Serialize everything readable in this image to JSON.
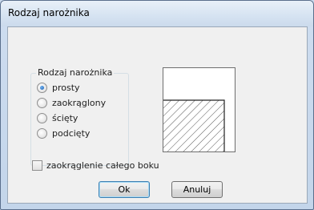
{
  "window": {
    "title": "Rodzaj narożnika"
  },
  "group": {
    "legend": "Rodzaj narożnika",
    "options": [
      {
        "label": "prosty",
        "checked": true
      },
      {
        "label": "zaokrąglony",
        "checked": false
      },
      {
        "label": "ścięty",
        "checked": false
      },
      {
        "label": "podcięty",
        "checked": false
      }
    ]
  },
  "checkbox": {
    "label": "zaokrąglenie całego boku",
    "checked": false
  },
  "buttons": {
    "ok": "Ok",
    "cancel": "Anuluj"
  },
  "colors": {
    "hatch": "#555555",
    "title_bar": "#d7e4f2",
    "client_bg": "#f0f0f0"
  }
}
